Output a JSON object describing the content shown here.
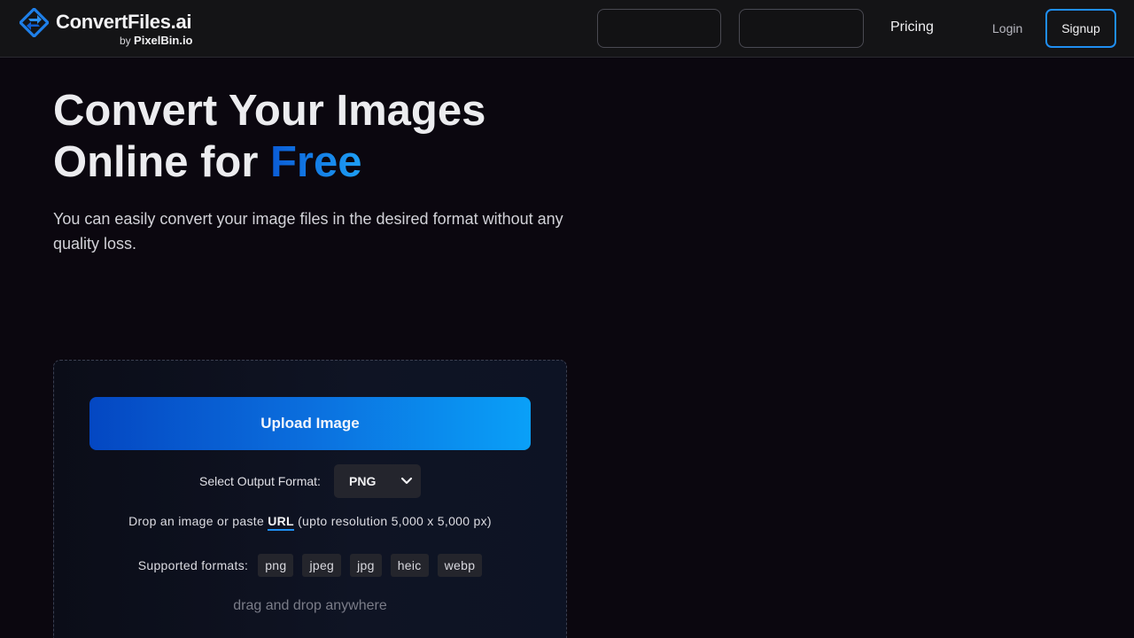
{
  "header": {
    "brand": "ConvertFiles",
    "brand_suffix": ".ai",
    "by_prefix": "by",
    "by_brand": "PixelBin.io",
    "nav_pricing": "Pricing",
    "nav_login": "Login",
    "nav_signup": "Signup"
  },
  "hero": {
    "title_line1": "Convert Your Images",
    "title_line2_prefix": "Online for ",
    "title_line2_accent": "Free",
    "description": "You can easily convert your image files in the desired format without any quality loss."
  },
  "upload": {
    "button_label": "Upload Image",
    "format_label": "Select Output Format:",
    "format_value": "PNG",
    "drop_prefix": "Drop an image or paste ",
    "drop_link": "URL",
    "drop_suffix": " (upto resolution 5,000 x 5,000 px)",
    "supported_label": "Supported formats:",
    "formats": [
      "png",
      "jpeg",
      "jpg",
      "heic",
      "webp"
    ],
    "dnd_hint": "drag and drop anywhere"
  },
  "colors": {
    "background": "#0b070f",
    "header_bg": "#141416",
    "accent_blue": "#1f8ef1",
    "upload_gradient_start": "#0447c2",
    "upload_gradient_end": "#0aa0f8"
  },
  "icons": {
    "logo": "convertfiles-logo-icon",
    "format_dropdown": "chevron-down-icon"
  }
}
